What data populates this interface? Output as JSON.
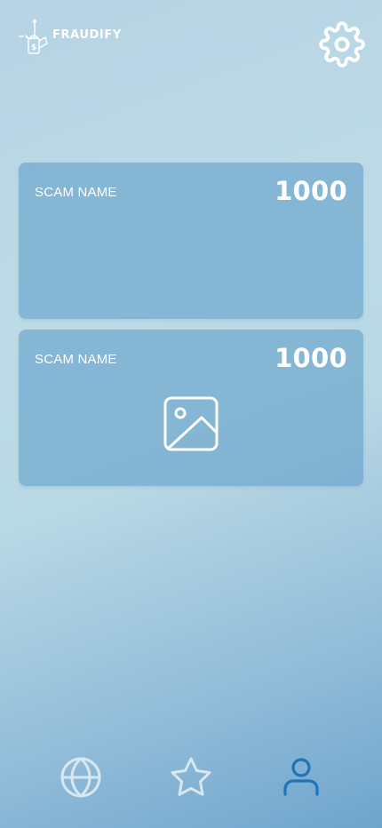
{
  "app": {
    "name": "FRAUDIFY",
    "logo_icon": "fishing-hook-bag-icon"
  },
  "header": {
    "settings_icon": "gear-icon"
  },
  "cards": [
    {
      "name": "SCAM NAME",
      "score": "1000",
      "has_image": false
    },
    {
      "name": "SCAM NAME",
      "score": "1000",
      "has_image": true,
      "image_icon": "image-placeholder-icon"
    }
  ],
  "nav": {
    "items": [
      {
        "id": "explore",
        "icon": "globe-icon",
        "active": false
      },
      {
        "id": "favorites",
        "icon": "star-icon",
        "active": false
      },
      {
        "id": "profile",
        "icon": "user-icon",
        "active": true
      }
    ]
  },
  "colors": {
    "background_light": "#bcdbe6",
    "background_dark": "#6ea5cc",
    "card": "#7fb4d6",
    "text": "#ffffff",
    "nav_inactive": "#d7e8f1",
    "nav_active": "#1f74b8"
  }
}
